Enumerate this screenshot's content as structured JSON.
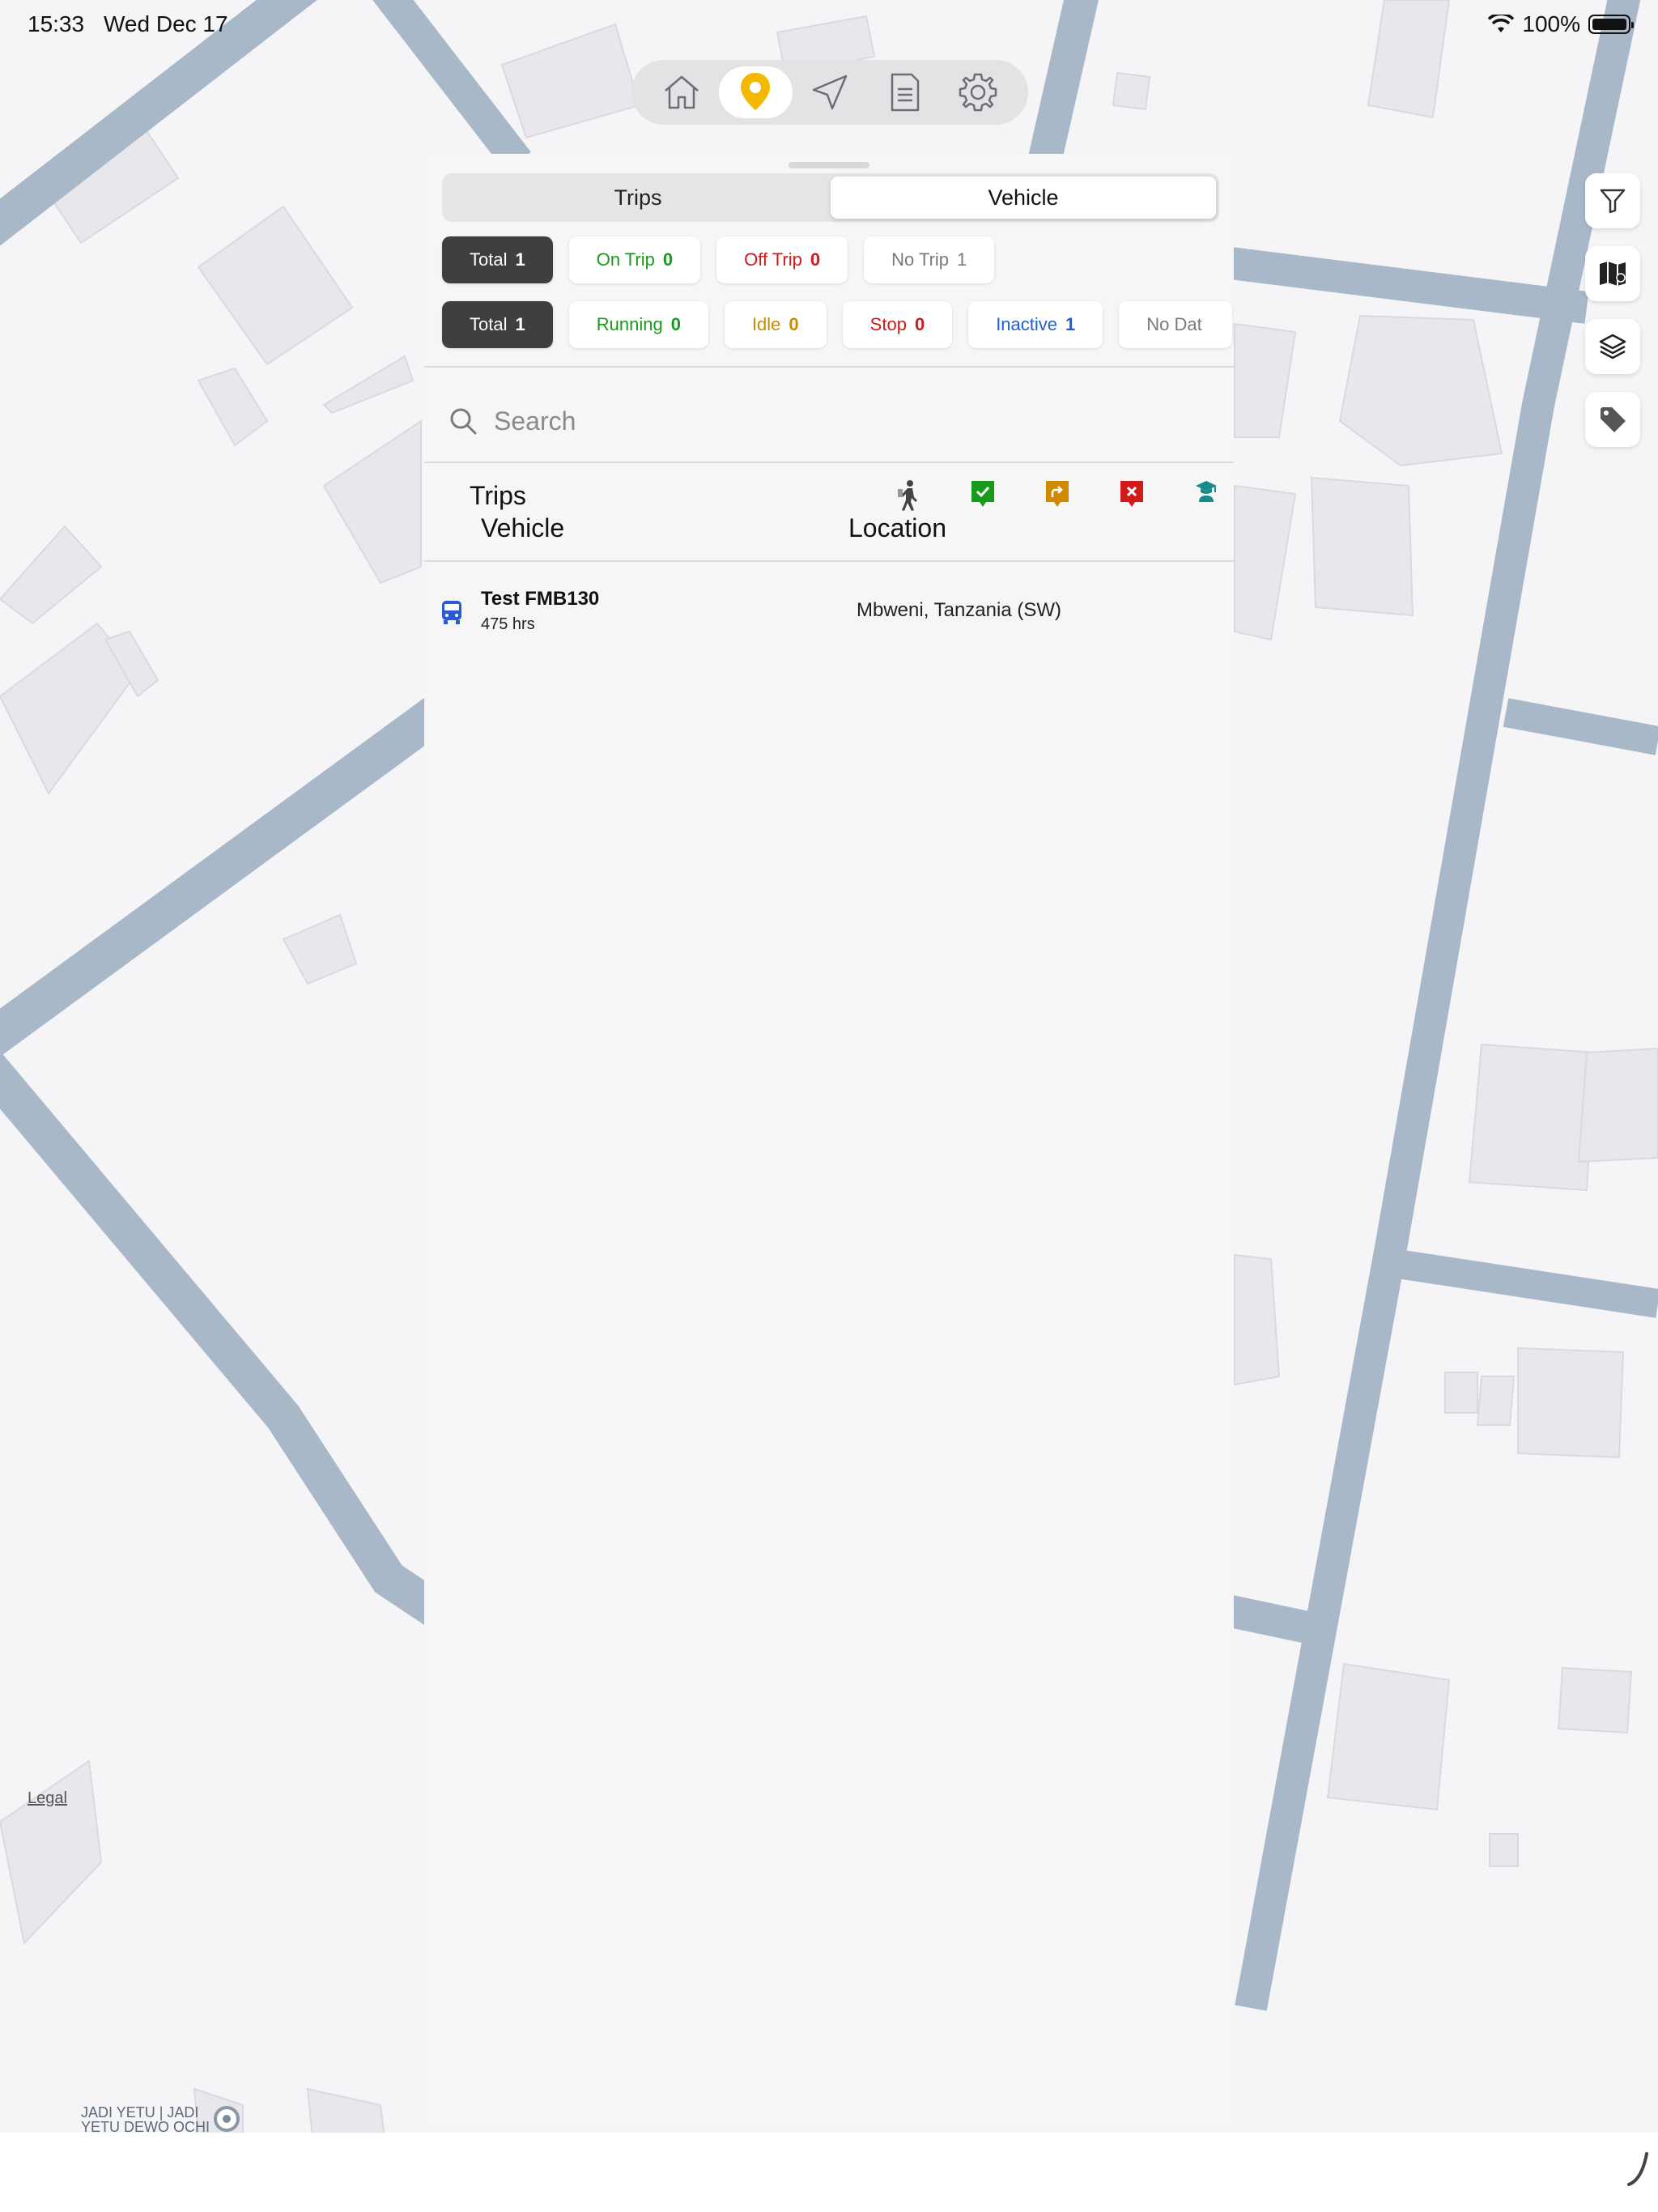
{
  "status_bar": {
    "time": "15:33",
    "date": "Wed Dec 17",
    "battery": "100%"
  },
  "nav": {
    "items": [
      {
        "name": "home-icon",
        "active": false
      },
      {
        "name": "location-pin-icon",
        "active": true
      },
      {
        "name": "navigation-arrow-icon",
        "active": false
      },
      {
        "name": "document-icon",
        "active": false
      },
      {
        "name": "gear-icon",
        "active": false
      }
    ]
  },
  "segment": {
    "tab1": "Trips",
    "tab2": "Vehicle",
    "selected": "Vehicle"
  },
  "trip_filters": [
    {
      "label": "Total",
      "count": "1",
      "color": "#ffffff"
    },
    {
      "label": "On Trip",
      "count": "0",
      "color": "#1a9a1a"
    },
    {
      "label": "Off Trip",
      "count": "0",
      "color": "#d11a1a"
    },
    {
      "label": "No Trip",
      "count": "1",
      "color": "#7a7a7a"
    }
  ],
  "vehicle_filters": [
    {
      "label": "Total",
      "count": "1",
      "color": "#ffffff"
    },
    {
      "label": "Running",
      "count": "0",
      "color": "#1a9a1a"
    },
    {
      "label": "Idle",
      "count": "0",
      "color": "#d08a00"
    },
    {
      "label": "Stop",
      "count": "0",
      "color": "#d11a1a"
    },
    {
      "label": "Inactive",
      "count": "1",
      "color": "#1f5fd6"
    },
    {
      "label": "No Dat",
      "count": "",
      "color": "#7a7a7a"
    }
  ],
  "search": {
    "placeholder": "Search"
  },
  "table_header": {
    "trips": "Trips",
    "vehicle": "Vehicle",
    "location": "Location"
  },
  "rows": [
    {
      "name": "Test FMB130",
      "hours": "475 hrs",
      "location": "Mbweni, Tanzania (SW)"
    }
  ],
  "map": {
    "legal": "Legal",
    "poi_line1": "JADI YETU | JADI",
    "poi_line2": "YETU DEWO OCHI"
  },
  "colors": {
    "accent": "#f5b800",
    "road": "#a9b8c9",
    "building": "#e8e8ec"
  }
}
